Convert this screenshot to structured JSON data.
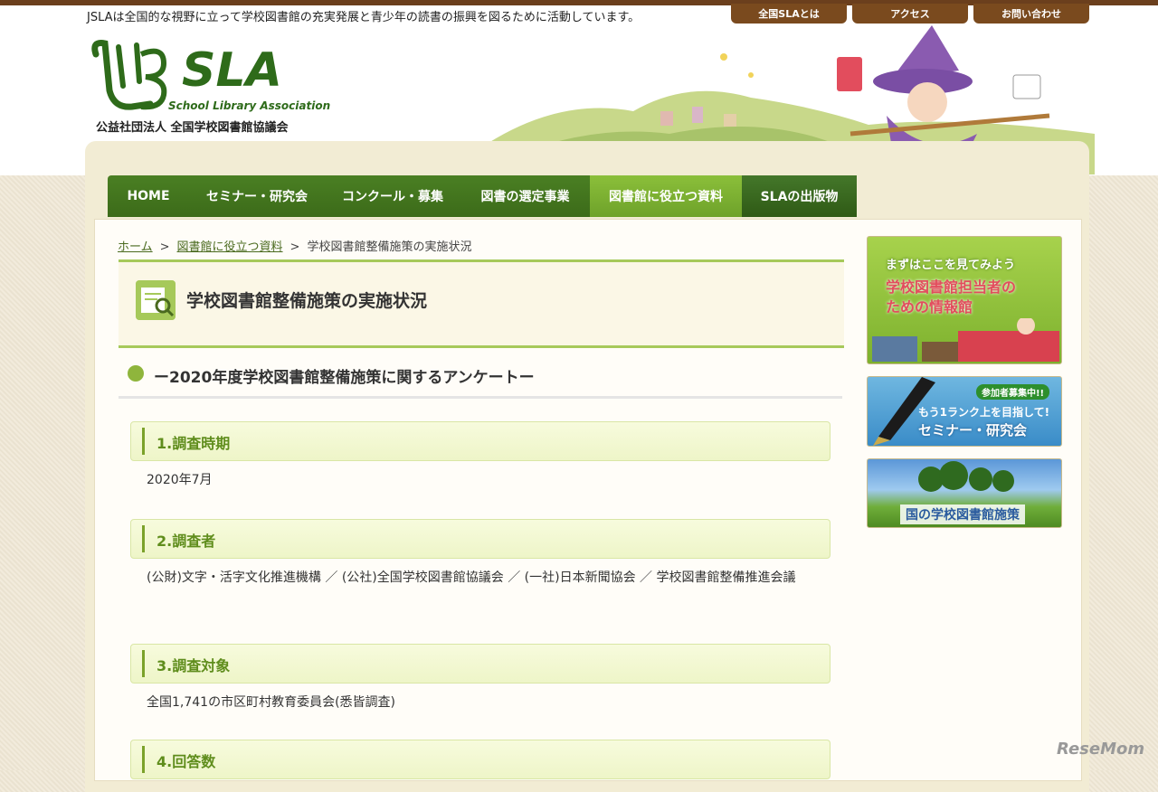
{
  "header": {
    "tagline": "JSLAは全国的な視野に立って学校図書館の充実発展と青少年の読書の振興を図るために活動しています。",
    "top_links": [
      "全国SLAとは",
      "アクセス",
      "お問い合わせ"
    ],
    "logo_en": "School Library Association",
    "logo_jp": "公益社団法人 全国学校図書館協議会"
  },
  "nav": {
    "items": [
      "HOME",
      "セミナー・研究会",
      "コンクール・募集",
      "図書の選定事業",
      "図書館に役立つ資料",
      "SLAの出版物"
    ],
    "active_index": 4
  },
  "breadcrumb": {
    "home": "ホーム",
    "parent": "図書館に役立つ資料",
    "current": "学校図書館整備施策の実施状況",
    "separator": ">"
  },
  "page": {
    "title": "学校図書館整備施策の実施状況",
    "subtitle": "ー2020年度学校図書館整備施策に関するアンケートー"
  },
  "sections": [
    {
      "title": "1.調査時期",
      "body": "2020年7月"
    },
    {
      "title": "2.調査者",
      "body": "(公財)文字・活字文化推進機構 ／ (公社)全国学校図書館協議会 ／ (一社)日本新聞協会 ／ 学校図書館整備推進会議"
    },
    {
      "title": "3.調査対象",
      "body": "全国1,741の市区町村教育委員会(悉皆調査)"
    },
    {
      "title": "4.回答数",
      "body": ""
    }
  ],
  "sidebar": {
    "banner1_line1": "まずはここを見てみよう",
    "banner1_line2": "学校図書館担当者の",
    "banner1_line3": "ための情報館",
    "banner2_badge": "参加者募集中!!",
    "banner2_line1": "もう1ランク上を目指して!",
    "banner2_line2": "セミナー・研究会",
    "banner3_label": "国の学校図書館施策"
  },
  "watermark": "ReseMom"
}
